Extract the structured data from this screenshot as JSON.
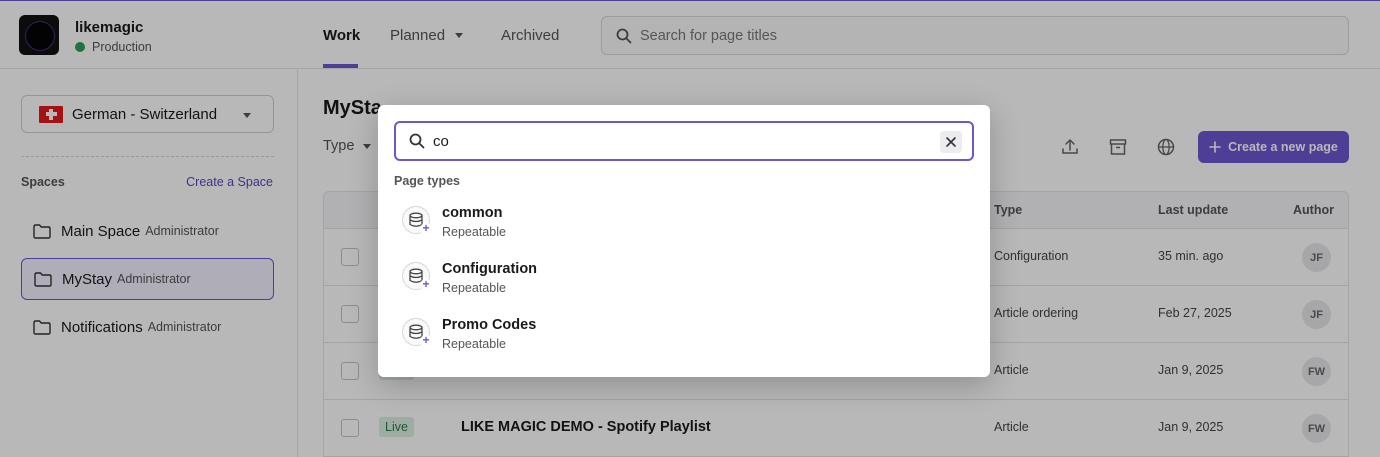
{
  "header": {
    "brand": "likemagic",
    "environment": "Production",
    "tabs": [
      {
        "label": "Work"
      },
      {
        "label": "Planned"
      },
      {
        "label": "Archived"
      }
    ],
    "search_placeholder": "Search for page titles",
    "accent_color": "#6e56cf"
  },
  "sidebar": {
    "locale": "German - Switzerland",
    "spaces_label": "Spaces",
    "create_space": "Create a Space",
    "spaces": [
      {
        "name": "Main Space",
        "role": "Administrator"
      },
      {
        "name": "MyStay",
        "role": "Administrator"
      },
      {
        "name": "Notifications",
        "role": "Administrator"
      }
    ]
  },
  "main": {
    "title": "MySta",
    "type_filter": "Type",
    "create_button": "Create a new page",
    "columns": {
      "type": "Type",
      "last_update": "Last update",
      "author": "Author"
    },
    "rows": [
      {
        "status": "",
        "title": "",
        "type": "Configuration",
        "updated": "35 min. ago",
        "author": "JF"
      },
      {
        "status": "",
        "title": "",
        "type": "Article ordering",
        "updated": "Feb 27, 2025",
        "author": "JF"
      },
      {
        "status": "",
        "title": "",
        "type": "Article",
        "updated": "Jan 9, 2025",
        "author": "FW"
      },
      {
        "status": "Live",
        "title": "LIKE MAGIC DEMO - Spotify Playlist",
        "type": "Article",
        "updated": "Jan 9, 2025",
        "author": "FW"
      }
    ]
  },
  "dialog": {
    "search_value": "co",
    "section_label": "Page types",
    "page_types": [
      {
        "name": "common",
        "kind": "Repeatable"
      },
      {
        "name": "Configuration",
        "kind": "Repeatable"
      },
      {
        "name": "Promo Codes",
        "kind": "Repeatable"
      }
    ]
  }
}
